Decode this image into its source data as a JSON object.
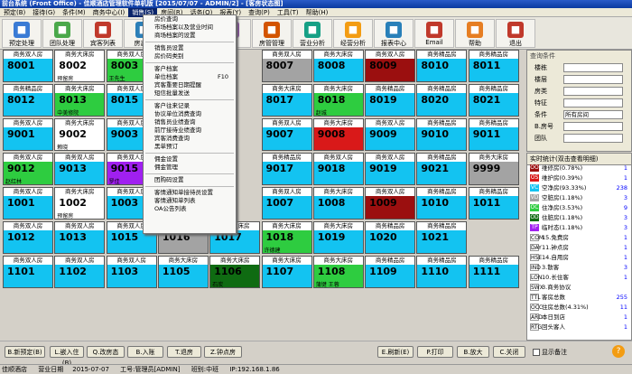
{
  "window": {
    "title": "前台系统 (Front Office) - 佳顺酒店管理软件单机版 [2015/07/07 - ADMIN/2] - [客房状态图]"
  },
  "menubar": [
    "预定(B)",
    "接待(G)",
    "条件(M)",
    "商务中心(I)",
    "销售(S)",
    "房间(R)",
    "话务(O)",
    "报表(Y)",
    "查询(P)",
    "工具(T)",
    "帮助(H)"
  ],
  "menubar_active_index": 4,
  "toolbar": [
    {
      "label": "预定处理",
      "icon": "calendar-icon",
      "color": "#3a7bd5"
    },
    {
      "label": "团队处理",
      "icon": "group-icon",
      "color": "#4aa84a"
    },
    {
      "label": "宾客列表",
      "icon": "list-icon",
      "color": "#c0392b"
    },
    {
      "label": "房态图",
      "icon": "grid-icon",
      "color": "#2c7fb8"
    },
    {
      "label": "房",
      "icon": "bed-icon",
      "color": "#8e44ad"
    },
    {
      "label": "房管管理",
      "icon": "house-icon",
      "color": "#d35400"
    },
    {
      "label": "营业分析",
      "icon": "bar-chart-icon",
      "color": "#16a085"
    },
    {
      "label": "经营分析",
      "icon": "pie-chart-icon",
      "color": "#f39c12"
    },
    {
      "label": "报表中心",
      "icon": "report-icon",
      "color": "#2980b9"
    },
    {
      "label": "Email",
      "icon": "email-icon",
      "color": "#c0392b"
    },
    {
      "label": "帮助",
      "icon": "help-icon",
      "color": "#e67e22"
    },
    {
      "label": "退出",
      "icon": "exit-icon",
      "color": "#c0392b"
    }
  ],
  "dropdown": [
    {
      "label": "房价查询"
    },
    {
      "label": "市场档案以及营业时间"
    },
    {
      "label": "商场档案的设置"
    },
    {
      "sep": true
    },
    {
      "label": "销售员设置"
    },
    {
      "label": "房价码类别"
    },
    {
      "sep": true
    },
    {
      "label": "客户档案"
    },
    {
      "label": "单位档案",
      "shortcut": "F10"
    },
    {
      "label": "宾客重要日期提醒"
    },
    {
      "label": "短信批量发送"
    },
    {
      "sep": true
    },
    {
      "label": "客户往来记录"
    },
    {
      "label": "协议单位消费查询"
    },
    {
      "label": "销售员业绩查询"
    },
    {
      "label": "前厅接待业绩查询"
    },
    {
      "label": "宾客消费查询"
    },
    {
      "label": "黑单预订"
    },
    {
      "sep": true
    },
    {
      "label": "佣金设置"
    },
    {
      "label": "佣金管理"
    },
    {
      "sep": true
    },
    {
      "label": "团购码设置"
    },
    {
      "sep": true
    },
    {
      "label": "客情通知单接待员设置"
    },
    {
      "label": "客情通知单列表"
    },
    {
      "label": "OA公告列表"
    }
  ],
  "rooms": [
    [
      {
        "type": "商务双人房",
        "num": "8001",
        "color": "#13c3f1"
      },
      {
        "type": "商务大床房",
        "num": "8002",
        "color": "#ffffff",
        "note": "预留房"
      },
      {
        "type": "商务双人房",
        "num": "8003",
        "color": "#2ecc40",
        "note": "王先生"
      },
      {
        "type": "",
        "num": "",
        "color": "#13c3f1",
        "hidden": true
      },
      {
        "type": "",
        "num": "",
        "color": "#13c3f1",
        "hidden": true
      },
      {
        "type": "商务双人房",
        "num": "8007",
        "color": "#a3a3a3"
      },
      {
        "type": "商务大床房",
        "num": "8008",
        "color": "#13c3f1"
      },
      {
        "type": "商务双人房",
        "num": "8009",
        "color": "#9b0f0f"
      },
      {
        "type": "商务精品房",
        "num": "8010",
        "color": "#13c3f1"
      },
      {
        "type": "商务精品房",
        "num": "8011",
        "color": "#13c3f1"
      }
    ],
    [
      {
        "type": "商务精品房",
        "num": "8012",
        "color": "#13c3f1"
      },
      {
        "type": "商务大床房",
        "num": "8013",
        "color": "#2ecc40",
        "note": "中美修院"
      },
      {
        "type": "商务双人房",
        "num": "8015",
        "color": "#13c3f1"
      },
      {
        "type": "",
        "num": "",
        "color": "#13c3f1",
        "hidden": true
      },
      {
        "type": "",
        "num": "",
        "color": "#13c3f1",
        "hidden": true
      },
      {
        "type": "商务大床房",
        "num": "8017",
        "color": "#13c3f1"
      },
      {
        "type": "商务大床房",
        "num": "8018",
        "color": "#2ecc40",
        "note": "赵城"
      },
      {
        "type": "商务精品房",
        "num": "8019",
        "color": "#13c3f1"
      },
      {
        "type": "商务精品房",
        "num": "8020",
        "color": "#13c3f1"
      },
      {
        "type": "商务精品房",
        "num": "8021",
        "color": "#13c3f1"
      }
    ],
    [
      {
        "type": "商务双人房",
        "num": "9001",
        "color": "#13c3f1"
      },
      {
        "type": "商务大床房",
        "num": "9002",
        "color": "#ffffff",
        "note": "赖晓"
      },
      {
        "type": "商务双人房",
        "num": "9003",
        "color": "#13c3f1"
      },
      {
        "type": "",
        "num": "",
        "color": "#13c3f1",
        "hidden": true
      },
      {
        "type": "",
        "num": "",
        "color": "#13c3f1",
        "hidden": true
      },
      {
        "type": "商务双人房",
        "num": "9007",
        "color": "#13c3f1"
      },
      {
        "type": "商务大床房",
        "num": "9008",
        "color": "#d91919"
      },
      {
        "type": "商务双人房",
        "num": "9009",
        "color": "#13c3f1"
      },
      {
        "type": "商务精品房",
        "num": "9010",
        "color": "#13c3f1"
      },
      {
        "type": "商务精品房",
        "num": "9011",
        "color": "#13c3f1"
      }
    ],
    [
      {
        "type": "商务双人房",
        "num": "9012",
        "color": "#2ecc40",
        "note": "赵红林"
      },
      {
        "type": "商务双人房",
        "num": "9013",
        "color": "#13c3f1"
      },
      {
        "type": "商务双人房",
        "num": "9015",
        "color": "#a020f0",
        "note": "罗佳"
      },
      {
        "type": "",
        "num": "",
        "color": "#13c3f1",
        "hidden": true
      },
      {
        "type": "",
        "num": "",
        "color": "#13c3f1",
        "hidden": true
      },
      {
        "type": "商务精品房",
        "num": "9017",
        "color": "#13c3f1"
      },
      {
        "type": "商务双人房",
        "num": "9018",
        "color": "#13c3f1"
      },
      {
        "type": "商务双人房",
        "num": "9019",
        "color": "#13c3f1"
      },
      {
        "type": "商务精品房",
        "num": "9021",
        "color": "#13c3f1"
      },
      {
        "type": "商务大床房",
        "num": "9999",
        "color": "#a3a3a3"
      }
    ],
    [
      {
        "type": "商务双人房",
        "num": "1001",
        "color": "#13c3f1"
      },
      {
        "type": "商务大床房",
        "num": "1002",
        "color": "#ffffff",
        "note": "预留房"
      },
      {
        "type": "商务双人房",
        "num": "1003",
        "color": "#13c3f1"
      },
      {
        "type": "",
        "num": "",
        "color": "#13c3f1",
        "hidden": true
      },
      {
        "type": "",
        "num": "",
        "color": "#13c3f1",
        "hidden": true
      },
      {
        "type": "商务双人房",
        "num": "1007",
        "color": "#13c3f1"
      },
      {
        "type": "商务大床房",
        "num": "1008",
        "color": "#13c3f1"
      },
      {
        "type": "商务双人房",
        "num": "1009",
        "color": "#9b0f0f"
      },
      {
        "type": "商务精品房",
        "num": "1010",
        "color": "#13c3f1"
      },
      {
        "type": "商务精品房",
        "num": "1011",
        "color": "#13c3f1"
      }
    ],
    [
      {
        "type": "商务双人房",
        "num": "1012",
        "color": "#13c3f1"
      },
      {
        "type": "商务双人房",
        "num": "1013",
        "color": "#13c3f1"
      },
      {
        "type": "商务双人房",
        "num": "1015",
        "color": "#13c3f1"
      },
      {
        "type": "商务大床房",
        "num": "1016",
        "color": "#a3a3a3"
      },
      {
        "type": "商务大床房",
        "num": "1017",
        "color": "#13c3f1"
      },
      {
        "type": "商务大床房",
        "num": "1018",
        "color": "#2ecc40",
        "note": "许德建"
      },
      {
        "type": "商务大床房",
        "num": "1019",
        "color": "#13c3f1"
      },
      {
        "type": "商务精品房",
        "num": "1020",
        "color": "#13c3f1"
      },
      {
        "type": "商务精品房",
        "num": "1021",
        "color": "#13c3f1"
      },
      {
        "type": "",
        "num": "",
        "color": "#d4d0c8",
        "hidden": true
      }
    ],
    [
      {
        "type": "商务双人房",
        "num": "1101",
        "color": "#13c3f1"
      },
      {
        "type": "商务双人房",
        "num": "1102",
        "color": "#13c3f1"
      },
      {
        "type": "商务双人房",
        "num": "1103",
        "color": "#13c3f1"
      },
      {
        "type": "商务大床房",
        "num": "1105",
        "color": "#13c3f1"
      },
      {
        "type": "商务大床房",
        "num": "1106",
        "color": "#0f6b12",
        "note": "石炭"
      },
      {
        "type": "商务大床房",
        "num": "1107",
        "color": "#13c3f1"
      },
      {
        "type": "商务大床房",
        "num": "1108",
        "color": "#2ecc40",
        "note": "蒲键 王蓉"
      },
      {
        "type": "商务精品房",
        "num": "1109",
        "color": "#13c3f1"
      },
      {
        "type": "商务精品房",
        "num": "1110",
        "color": "#13c3f1"
      },
      {
        "type": "商务精品房",
        "num": "1111",
        "color": "#13c3f1"
      }
    ]
  ],
  "query": {
    "title": "查询条件",
    "rows": [
      {
        "label": "楼栋",
        "value": ""
      },
      {
        "label": "楼层",
        "value": ""
      },
      {
        "label": "房类",
        "value": ""
      },
      {
        "label": "特征",
        "value": ""
      },
      {
        "label": "条件",
        "value": "所有房间"
      },
      {
        "label": "B.房号",
        "value": ""
      },
      {
        "label": "团队",
        "value": ""
      }
    ]
  },
  "stats": {
    "title": "实时统计(双击查看明细)",
    "rows": [
      {
        "code": "OO",
        "label": "维修房(0.78%)",
        "count": "1",
        "color": "#9b0f0f"
      },
      {
        "code": "OS",
        "label": "维护房(0.39%)",
        "count": "1",
        "color": "#d91919"
      },
      {
        "code": "VC",
        "label": "空净房(93.33%)",
        "count": "238",
        "color": "#13c3f1"
      },
      {
        "code": "VD",
        "label": "空脏房(1.18%)",
        "count": "3",
        "color": "#a3a3a3"
      },
      {
        "code": "OC",
        "label": "住净房(3.53%)",
        "count": "9",
        "color": "#2ecc40"
      },
      {
        "code": "OD",
        "label": "住脏房(1.18%)",
        "count": "3",
        "color": "#0f6b12"
      },
      {
        "code": "TP",
        "label": "临时态(1.18%)",
        "count": "3",
        "color": "#a020f0"
      },
      {
        "code": "COM",
        "label": "15.免费房",
        "count": "1",
        "color": "#ffffff"
      },
      {
        "code": "DAY",
        "label": "11.钟点房",
        "count": "1",
        "color": "#ffffff"
      },
      {
        "code": "HSE",
        "label": "14.自用房",
        "count": "1",
        "color": "#ffffff"
      },
      {
        "code": "IND",
        "label": "3.散客",
        "count": "3",
        "color": "#ffffff"
      },
      {
        "code": "LON",
        "label": "10.长住客",
        "count": "1",
        "color": "#ffffff"
      },
      {
        "code": "SWX",
        "label": "3.商务协议",
        "count": "",
        "color": "#ffffff"
      },
      {
        "code": "TTL",
        "label": "客房总数",
        "count": "255",
        "color": "#ffffff"
      },
      {
        "code": "OCC",
        "label": "住房总数(4.31%)",
        "count": "11",
        "color": "#ffffff"
      },
      {
        "code": "ARD",
        "label": "本日到店",
        "count": "1",
        "color": "#ffffff"
      },
      {
        "code": "RTG",
        "label": "回头客人",
        "count": "1",
        "color": "#ffffff"
      }
    ]
  },
  "bottom_buttons": [
    "B.新预定(B)",
    "L.嵌入住(B)",
    "Q.改房态",
    "B.入账",
    "T.退房",
    "Z.钟点房",
    "E.刷新(E)",
    "P.打印",
    "B.放大",
    "C.关闭"
  ],
  "bottom_checkbox": {
    "label": "显示备注"
  },
  "status": {
    "hotel": "佳顺酒店",
    "bizdate_label": "营业日期",
    "bizdate": "2015-07-07",
    "operator": "工号:管理员[ADMIN]",
    "shift": "班别:中班",
    "ip": "IP:192.168.1.86"
  }
}
